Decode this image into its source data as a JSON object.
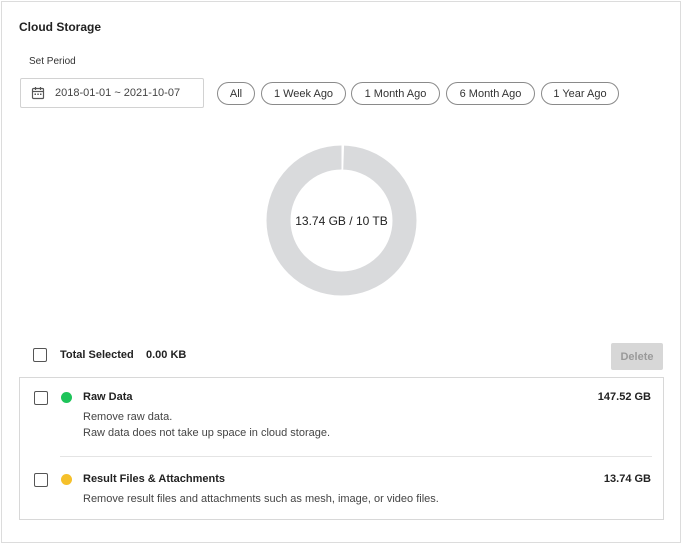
{
  "panel": {
    "title": "Cloud Storage",
    "set_period_label": "Set Period",
    "date_range_value": "2018-01-01 ~ 2021-10-07"
  },
  "period_buttons": [
    {
      "label": "All"
    },
    {
      "label": "1 Week Ago"
    },
    {
      "label": "1 Month Ago"
    },
    {
      "label": "6 Month Ago"
    },
    {
      "label": "1 Year Ago"
    }
  ],
  "usage": {
    "label": "13.74 GB / 10 TB",
    "used_fraction": 0.0014,
    "ring_color": "#d9dadc",
    "used_color": "#ffffff"
  },
  "selection": {
    "total_label": "Total Selected",
    "total_value": "0.00 KB",
    "delete_label": "Delete"
  },
  "items": [
    {
      "title": "Raw Data",
      "size": "147.52 GB",
      "desc_line1": "Remove raw data.",
      "desc_line2": "Raw data does not take up space in cloud storage.",
      "dot_color": "#1ec45a"
    },
    {
      "title": "Result Files & Attachments",
      "size": "13.74 GB",
      "desc_line1": "Remove result files and attachments such as mesh, image, or video files.",
      "dot_color": "#f5c02a"
    }
  ],
  "icons": {
    "date_field": "calendar-icon"
  }
}
